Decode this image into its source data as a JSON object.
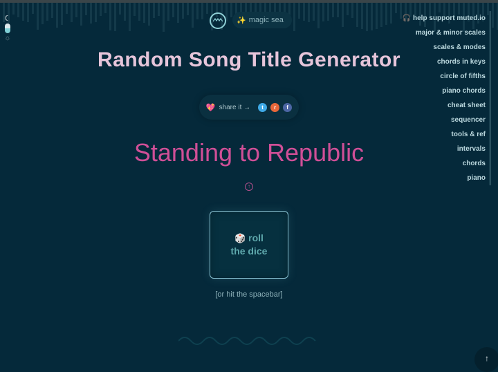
{
  "header": {
    "magic_label": "magic sea",
    "magic_icon": "sparkles-icon",
    "logo_icon": "wave-logo-icon"
  },
  "theme_toggle": {
    "moon_icon": "moon-icon",
    "sun_icon": "sun-icon",
    "mode": "dark"
  },
  "nav": {
    "items": [
      {
        "label": "help support muted.io",
        "icon": "headphones-icon"
      },
      {
        "label": "major & minor scales"
      },
      {
        "label": "scales & modes"
      },
      {
        "label": "chords in keys"
      },
      {
        "label": "circle of fifths"
      },
      {
        "label": "piano chords"
      },
      {
        "label": "cheat sheet"
      },
      {
        "label": "sequencer"
      },
      {
        "label": "tools & ref"
      },
      {
        "label": "intervals"
      },
      {
        "label": "chords"
      },
      {
        "label": "piano"
      }
    ]
  },
  "page": {
    "title": "Random Song Title Generator"
  },
  "share": {
    "label": "share it →",
    "heart_icon": "heart-icon",
    "networks": [
      "twitter",
      "reddit",
      "facebook"
    ]
  },
  "result": {
    "song_title": "Standing to Republic"
  },
  "roll_button": {
    "line1": "roll",
    "line2": "the dice",
    "hint": "[or hit the spacebar]"
  },
  "colors": {
    "background": "#05293a",
    "title": "#e6c5da",
    "song_title": "#d04f97",
    "button_text": "#5fa9ad",
    "button_border": "#86bfd0"
  }
}
